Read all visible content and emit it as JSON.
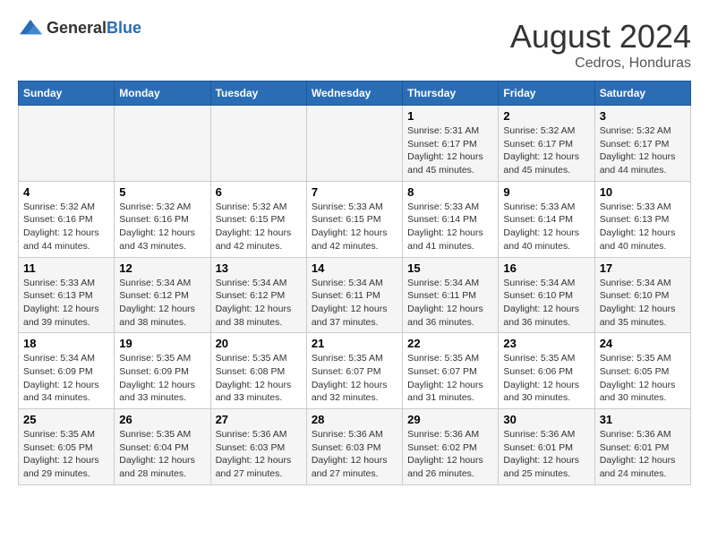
{
  "header": {
    "logo_general": "General",
    "logo_blue": "Blue",
    "main_title": "August 2024",
    "sub_title": "Cedros, Honduras"
  },
  "calendar": {
    "days_of_week": [
      "Sunday",
      "Monday",
      "Tuesday",
      "Wednesday",
      "Thursday",
      "Friday",
      "Saturday"
    ],
    "weeks": [
      [
        {
          "day": "",
          "info": ""
        },
        {
          "day": "",
          "info": ""
        },
        {
          "day": "",
          "info": ""
        },
        {
          "day": "",
          "info": ""
        },
        {
          "day": "1",
          "info": "Sunrise: 5:31 AM\nSunset: 6:17 PM\nDaylight: 12 hours and 45 minutes."
        },
        {
          "day": "2",
          "info": "Sunrise: 5:32 AM\nSunset: 6:17 PM\nDaylight: 12 hours and 45 minutes."
        },
        {
          "day": "3",
          "info": "Sunrise: 5:32 AM\nSunset: 6:17 PM\nDaylight: 12 hours and 44 minutes."
        }
      ],
      [
        {
          "day": "4",
          "info": "Sunrise: 5:32 AM\nSunset: 6:16 PM\nDaylight: 12 hours and 44 minutes."
        },
        {
          "day": "5",
          "info": "Sunrise: 5:32 AM\nSunset: 6:16 PM\nDaylight: 12 hours and 43 minutes."
        },
        {
          "day": "6",
          "info": "Sunrise: 5:32 AM\nSunset: 6:15 PM\nDaylight: 12 hours and 42 minutes."
        },
        {
          "day": "7",
          "info": "Sunrise: 5:33 AM\nSunset: 6:15 PM\nDaylight: 12 hours and 42 minutes."
        },
        {
          "day": "8",
          "info": "Sunrise: 5:33 AM\nSunset: 6:14 PM\nDaylight: 12 hours and 41 minutes."
        },
        {
          "day": "9",
          "info": "Sunrise: 5:33 AM\nSunset: 6:14 PM\nDaylight: 12 hours and 40 minutes."
        },
        {
          "day": "10",
          "info": "Sunrise: 5:33 AM\nSunset: 6:13 PM\nDaylight: 12 hours and 40 minutes."
        }
      ],
      [
        {
          "day": "11",
          "info": "Sunrise: 5:33 AM\nSunset: 6:13 PM\nDaylight: 12 hours and 39 minutes."
        },
        {
          "day": "12",
          "info": "Sunrise: 5:34 AM\nSunset: 6:12 PM\nDaylight: 12 hours and 38 minutes."
        },
        {
          "day": "13",
          "info": "Sunrise: 5:34 AM\nSunset: 6:12 PM\nDaylight: 12 hours and 38 minutes."
        },
        {
          "day": "14",
          "info": "Sunrise: 5:34 AM\nSunset: 6:11 PM\nDaylight: 12 hours and 37 minutes."
        },
        {
          "day": "15",
          "info": "Sunrise: 5:34 AM\nSunset: 6:11 PM\nDaylight: 12 hours and 36 minutes."
        },
        {
          "day": "16",
          "info": "Sunrise: 5:34 AM\nSunset: 6:10 PM\nDaylight: 12 hours and 36 minutes."
        },
        {
          "day": "17",
          "info": "Sunrise: 5:34 AM\nSunset: 6:10 PM\nDaylight: 12 hours and 35 minutes."
        }
      ],
      [
        {
          "day": "18",
          "info": "Sunrise: 5:34 AM\nSunset: 6:09 PM\nDaylight: 12 hours and 34 minutes."
        },
        {
          "day": "19",
          "info": "Sunrise: 5:35 AM\nSunset: 6:09 PM\nDaylight: 12 hours and 33 minutes."
        },
        {
          "day": "20",
          "info": "Sunrise: 5:35 AM\nSunset: 6:08 PM\nDaylight: 12 hours and 33 minutes."
        },
        {
          "day": "21",
          "info": "Sunrise: 5:35 AM\nSunset: 6:07 PM\nDaylight: 12 hours and 32 minutes."
        },
        {
          "day": "22",
          "info": "Sunrise: 5:35 AM\nSunset: 6:07 PM\nDaylight: 12 hours and 31 minutes."
        },
        {
          "day": "23",
          "info": "Sunrise: 5:35 AM\nSunset: 6:06 PM\nDaylight: 12 hours and 30 minutes."
        },
        {
          "day": "24",
          "info": "Sunrise: 5:35 AM\nSunset: 6:05 PM\nDaylight: 12 hours and 30 minutes."
        }
      ],
      [
        {
          "day": "25",
          "info": "Sunrise: 5:35 AM\nSunset: 6:05 PM\nDaylight: 12 hours and 29 minutes."
        },
        {
          "day": "26",
          "info": "Sunrise: 5:35 AM\nSunset: 6:04 PM\nDaylight: 12 hours and 28 minutes."
        },
        {
          "day": "27",
          "info": "Sunrise: 5:36 AM\nSunset: 6:03 PM\nDaylight: 12 hours and 27 minutes."
        },
        {
          "day": "28",
          "info": "Sunrise: 5:36 AM\nSunset: 6:03 PM\nDaylight: 12 hours and 27 minutes."
        },
        {
          "day": "29",
          "info": "Sunrise: 5:36 AM\nSunset: 6:02 PM\nDaylight: 12 hours and 26 minutes."
        },
        {
          "day": "30",
          "info": "Sunrise: 5:36 AM\nSunset: 6:01 PM\nDaylight: 12 hours and 25 minutes."
        },
        {
          "day": "31",
          "info": "Sunrise: 5:36 AM\nSunset: 6:01 PM\nDaylight: 12 hours and 24 minutes."
        }
      ]
    ]
  }
}
